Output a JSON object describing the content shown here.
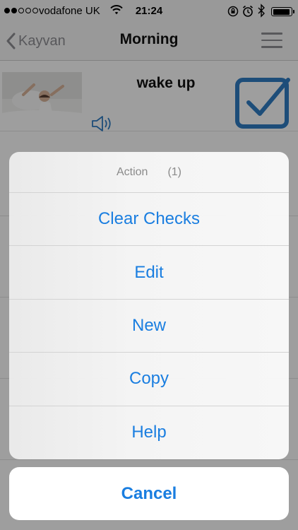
{
  "status_bar": {
    "carrier": "vodafone UK",
    "time": "21:24",
    "signal_bars_filled": 2,
    "signal_bars_total": 5,
    "battery_level": 0.92
  },
  "nav": {
    "back_label": "Kayvan",
    "title": "Morning",
    "back_icon": "chevron-left-icon",
    "menu_icon": "hamburger-icon"
  },
  "routine": [
    {
      "title": "wake up",
      "checked": true
    }
  ],
  "action_sheet": {
    "title": "Action",
    "count": "(1)",
    "items": [
      "Clear Checks",
      "Edit",
      "New",
      "Copy",
      "Help"
    ],
    "cancel_label": "Cancel"
  },
  "colors": {
    "accent": "#1a7ee0",
    "checkbox_blue": "#2f7cc4",
    "bar_bg": "#f7f7f7",
    "muted_gray": "#8e8e93"
  }
}
